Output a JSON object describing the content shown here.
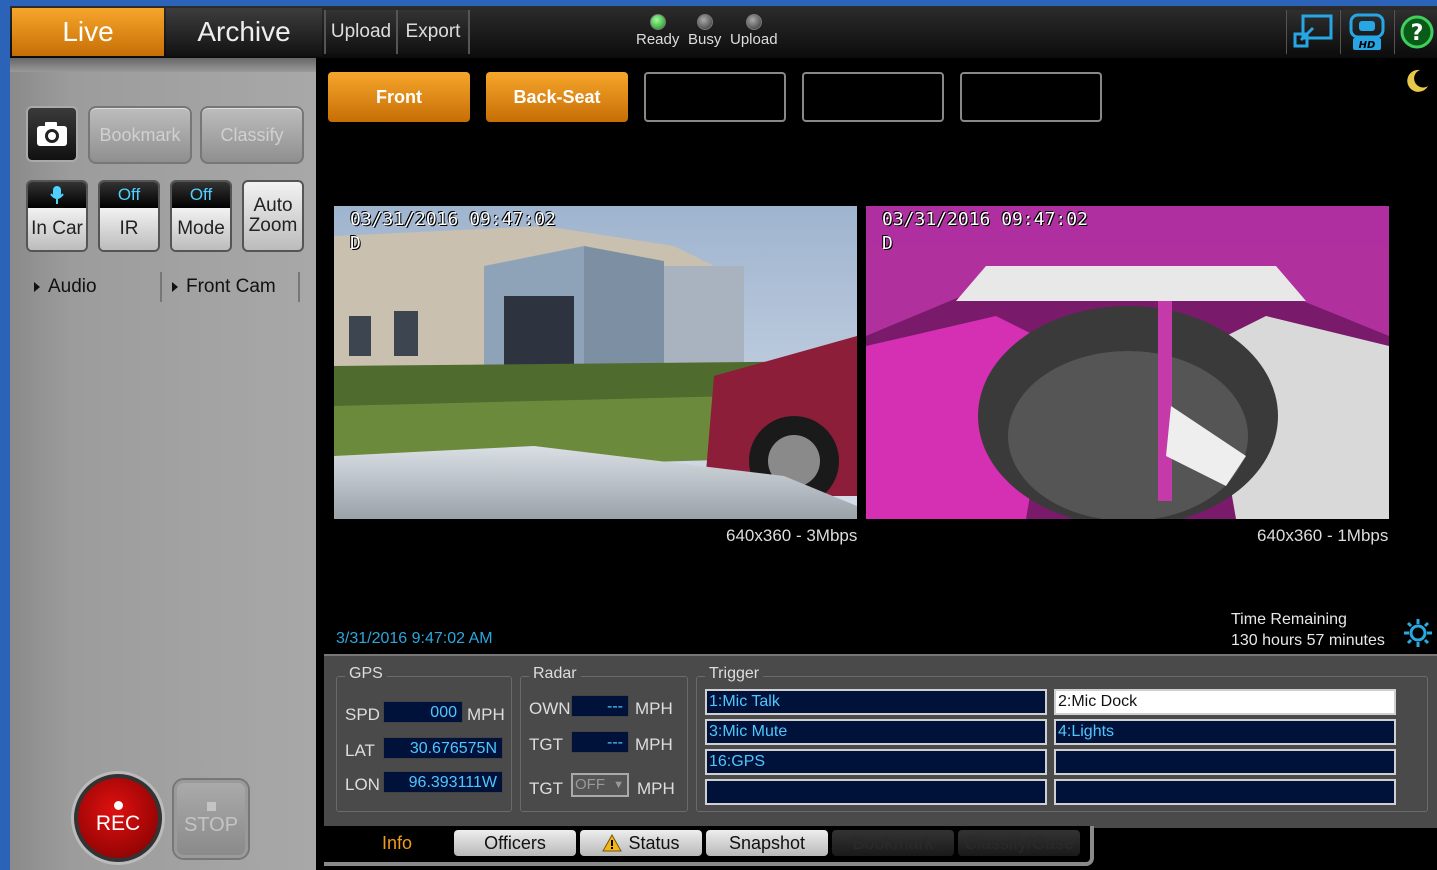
{
  "topbar": {
    "tab_live": "Live",
    "tab_archive": "Archive",
    "upload": "Upload",
    "export": "Export",
    "indicators": [
      {
        "label": "Ready",
        "state": "on",
        "color": "#22aa22"
      },
      {
        "label": "Busy",
        "state": "off",
        "color": "#666666"
      },
      {
        "label": "Upload",
        "state": "off",
        "color": "#666666"
      }
    ],
    "icons": [
      "display-icon",
      "hd-camera-icon",
      "help-icon"
    ],
    "help_symbol": "?",
    "hd_text": "HD"
  },
  "left": {
    "camera_button_icon": "camera-icon",
    "bookmark": "Bookmark",
    "classify": "Classify",
    "toggles": [
      {
        "status_icon": "microphone-icon",
        "label": "In Car"
      },
      {
        "status": "Off",
        "label": "IR"
      },
      {
        "status": "Off",
        "label": "Mode"
      }
    ],
    "auto_zoom": {
      "line1": "Auto",
      "line2": "Zoom"
    },
    "audio": "Audio",
    "front_cam": "Front Cam",
    "rec": "REC",
    "stop": "STOP"
  },
  "main": {
    "camera_tabs": [
      "Front",
      "Back-Seat",
      "",
      "",
      ""
    ],
    "night_icon": "moon-icon",
    "videos": [
      {
        "date": "03/31/2016",
        "time": "09:47:02",
        "flag": "D",
        "resolution": "640x360 - 3Mbps"
      },
      {
        "date": "03/31/2016",
        "time": "09:47:02",
        "flag": "D",
        "resolution": "640x360 - 1Mbps"
      }
    ],
    "timestamp": "3/31/2016 9:47:02 AM",
    "time_remaining_label": "Time Remaining",
    "time_remaining_value": "130 hours 57 minutes",
    "settings_icon": "sun-icon"
  },
  "info": {
    "gps": {
      "legend": "GPS",
      "spd_label": "SPD",
      "spd": "000",
      "spd_unit": "MPH",
      "lat_label": "LAT",
      "lat": "30.676575N",
      "lon_label": "LON",
      "lon": "96.393111W"
    },
    "radar": {
      "legend": "Radar",
      "own_label": "OWN",
      "own": "---",
      "own_unit": "MPH",
      "tgt_label": "TGT",
      "tgt": "---",
      "tgt_unit": "MPH",
      "tgt2_label": "TGT",
      "tgt2_select": "OFF",
      "tgt2_unit": "MPH"
    },
    "trigger": {
      "legend": "Trigger",
      "items": [
        "1:Mic Talk",
        "2:Mic Dock",
        "3:Mic Mute",
        "4:Lights",
        "16:GPS",
        "",
        "",
        ""
      ]
    }
  },
  "bottom_tabs": {
    "info": "Info",
    "officers": "Officers",
    "status": "Status",
    "snapshot": "Snapshot",
    "bookmark": "Bookmark",
    "classify_case": "Classify/Case"
  }
}
